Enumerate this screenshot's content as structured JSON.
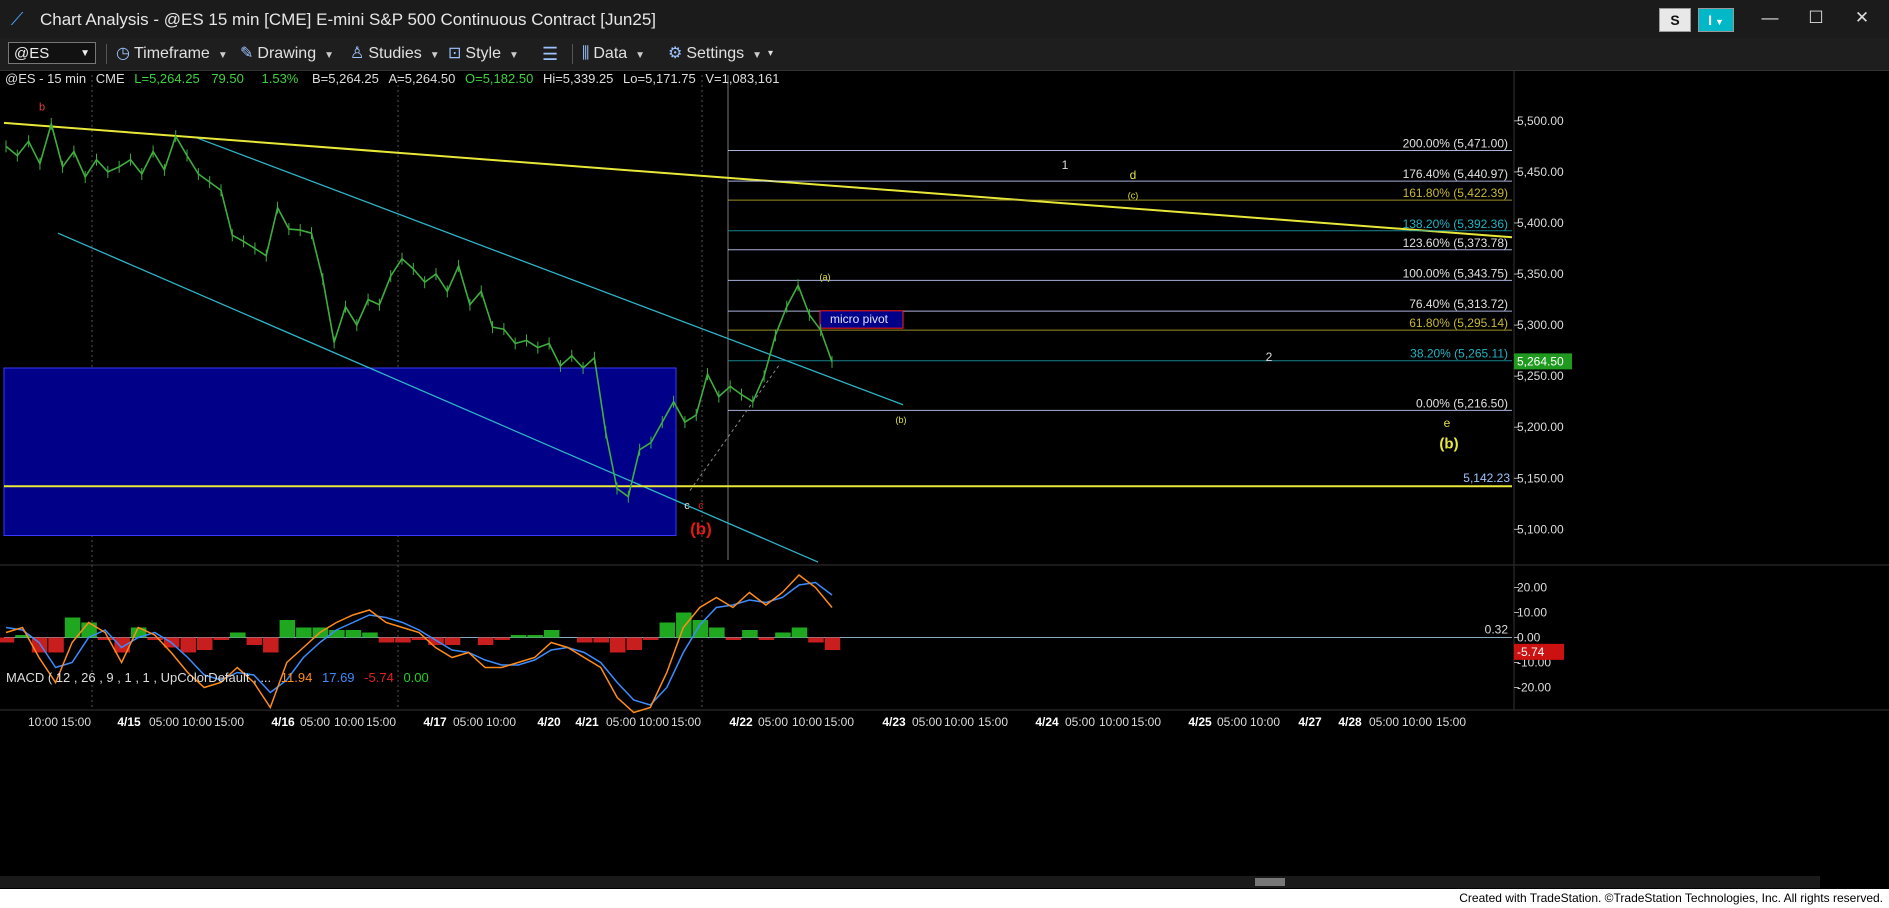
{
  "window": {
    "title": "Chart Analysis - @ES 15 min [CME] E-mini S&P 500 Continuous Contract [Jun25]",
    "s_button": "S",
    "i_button": "I"
  },
  "toolbar": {
    "symbol": "@ES",
    "timeframe": "Timeframe",
    "drawing": "Drawing",
    "studies": "Studies",
    "style": "Style",
    "data": "Data",
    "settings": "Settings"
  },
  "infobar": {
    "symbol": "@ES - 15 min",
    "exchange": "CME",
    "last": "L=5,264.25",
    "change": "79.50",
    "pct": "1.53%",
    "bid": "B=5,264.25",
    "ask": "A=5,264.50",
    "open": "O=5,182.50",
    "high": "Hi=5,339.25",
    "low": "Lo=5,171.75",
    "volume": "V=1,083,161"
  },
  "macd_label": {
    "name": "MACD ( 12 , 26 , 9 , 1 , 1 , UpColorDefault , ...",
    "v1": "11.94",
    "v2": "17.69",
    "v3": "-5.74",
    "v4": "0.00"
  },
  "colors": {
    "background": "#000000",
    "price": "#3fae3f",
    "trendline": "#e8e838",
    "channel": "#2fb3c8",
    "zone": "#000088",
    "wave_red": "#e01818",
    "macd_line": "#3c8cff",
    "signal_line": "#ff8c1a",
    "hist_up": "#1fa81f",
    "hist_down": "#c81e1e",
    "last_price_bg": "#1f9a1f",
    "neg_label_bg": "#cc1111"
  },
  "chart_data": [
    {
      "type": "line",
      "title": "@ES 15 min",
      "ylim": [
        5070,
        5540
      ],
      "y_ticks": [
        "5,500.00",
        "5,450.00",
        "5,400.00",
        "5,350.00",
        "5,300.00",
        "5,250.00",
        "5,200.00",
        "5,150.00",
        "5,100.00"
      ],
      "y_tick_values": [
        5500,
        5450,
        5400,
        5350,
        5300,
        5250,
        5200,
        5150,
        5100
      ],
      "x_ticks": [
        "10:00",
        "15:00",
        "4/15",
        "05:00",
        "10:00",
        "15:00",
        "4/16",
        "05:00",
        "10:00",
        "15:00",
        "4/17",
        "05:00",
        "10:00",
        "4/20",
        "4/21",
        "05:00",
        "10:00",
        "15:00",
        "4/22",
        "05:00",
        "10:00",
        "15:00",
        "4/23",
        "05:00",
        "10:00",
        "15:00",
        "4/24",
        "05:00",
        "10:00",
        "15:00",
        "4/25",
        "05:00",
        "10:00",
        "4/27",
        "4/28",
        "05:00",
        "10:00",
        "15:00"
      ],
      "series": [
        {
          "values": [
            5475,
            5466,
            5480,
            5458,
            5497,
            5455,
            5470,
            5445,
            5462,
            5450,
            5455,
            5462,
            5448,
            5470,
            5452,
            5485,
            5466,
            5448,
            5440,
            5432,
            5388,
            5382,
            5375,
            5368,
            5415,
            5394,
            5393,
            5390,
            5345,
            5283,
            5318,
            5300,
            5325,
            5320,
            5348,
            5365,
            5355,
            5342,
            5350,
            5333,
            5358,
            5320,
            5333,
            5298,
            5296,
            5282,
            5285,
            5278,
            5282,
            5260,
            5270,
            5258,
            5268,
            5195,
            5140,
            5132,
            5178,
            5185,
            5205,
            5225,
            5205,
            5212,
            5252,
            5230,
            5240,
            5232,
            5225,
            5250,
            5290,
            5318,
            5339,
            5310,
            5295,
            5264
          ]
        }
      ],
      "fib_levels": [
        {
          "pct": "200.00%",
          "value": 5471.0,
          "label": "200.00% (5,471.00)"
        },
        {
          "pct": "176.40%",
          "value": 5440.97,
          "label": "176.40% (5,440.97)"
        },
        {
          "pct": "161.80%",
          "value": 5422.39,
          "label": "161.80% (5,422.39)"
        },
        {
          "pct": "138.20%",
          "value": 5392.36,
          "label": "138.20% (5,392.36)"
        },
        {
          "pct": "123.60%",
          "value": 5373.78,
          "label": "123.60% (5,373.78)"
        },
        {
          "pct": "100.00%",
          "value": 5343.75,
          "label": "100.00% (5,343.75)"
        },
        {
          "pct": "76.40%",
          "value": 5313.72,
          "label": "76.40% (5,313.72)"
        },
        {
          "pct": "61.80%",
          "value": 5295.14,
          "label": "61.80% (5,295.14)"
        },
        {
          "pct": "38.20%",
          "value": 5265.11,
          "label": "38.20% (5,265.11)"
        },
        {
          "pct": "0.00%",
          "value": 5216.5,
          "label": "0.00% (5,216.50)"
        }
      ],
      "last_price": "5,264.50",
      "horizontal_line": {
        "value": 5142.23,
        "label": "5,142.23"
      },
      "annotations": [
        "b",
        "1",
        "d",
        "(c)",
        "(a)",
        "micro pivot",
        "2",
        "(b)",
        "e",
        "(b)",
        "c",
        "c",
        "(b)"
      ]
    },
    {
      "type": "line",
      "title": "MACD",
      "ylim": [
        -27,
        27
      ],
      "y_ticks": [
        "20.00",
        "10.00",
        "0.00",
        "-10.00",
        "-20.00"
      ],
      "y_tick_values": [
        20,
        10,
        0,
        -10,
        -20
      ],
      "zero_label": "0.32",
      "current_label": "-5.74",
      "series": [
        {
          "name": "MACD",
          "values": [
            2,
            4,
            -8,
            -18,
            -2,
            6,
            2,
            -10,
            4,
            1,
            -6,
            -14,
            -20,
            -18,
            -12,
            -18,
            -28,
            -10,
            -4,
            2,
            6,
            9,
            11,
            6,
            4,
            2,
            -4,
            -8,
            -6,
            -12,
            -12,
            -10,
            -8,
            -2,
            -4,
            -8,
            -12,
            -24,
            -30,
            -28,
            -14,
            4,
            12,
            16,
            12,
            18,
            13,
            18,
            25,
            20,
            12
          ]
        },
        {
          "name": "Signal",
          "values": [
            4,
            3,
            -2,
            -12,
            -10,
            0,
            3,
            -4,
            0,
            2,
            -2,
            -8,
            -15,
            -17,
            -14,
            -15,
            -22,
            -17,
            -8,
            -2,
            3,
            6,
            9,
            8,
            6,
            3,
            -1,
            -5,
            -6,
            -9,
            -11,
            -11,
            -9,
            -5,
            -4,
            -6,
            -10,
            -18,
            -25,
            -27,
            -20,
            -6,
            5,
            12,
            13,
            15,
            14,
            16,
            21,
            22,
            17
          ]
        }
      ]
    }
  ]
}
